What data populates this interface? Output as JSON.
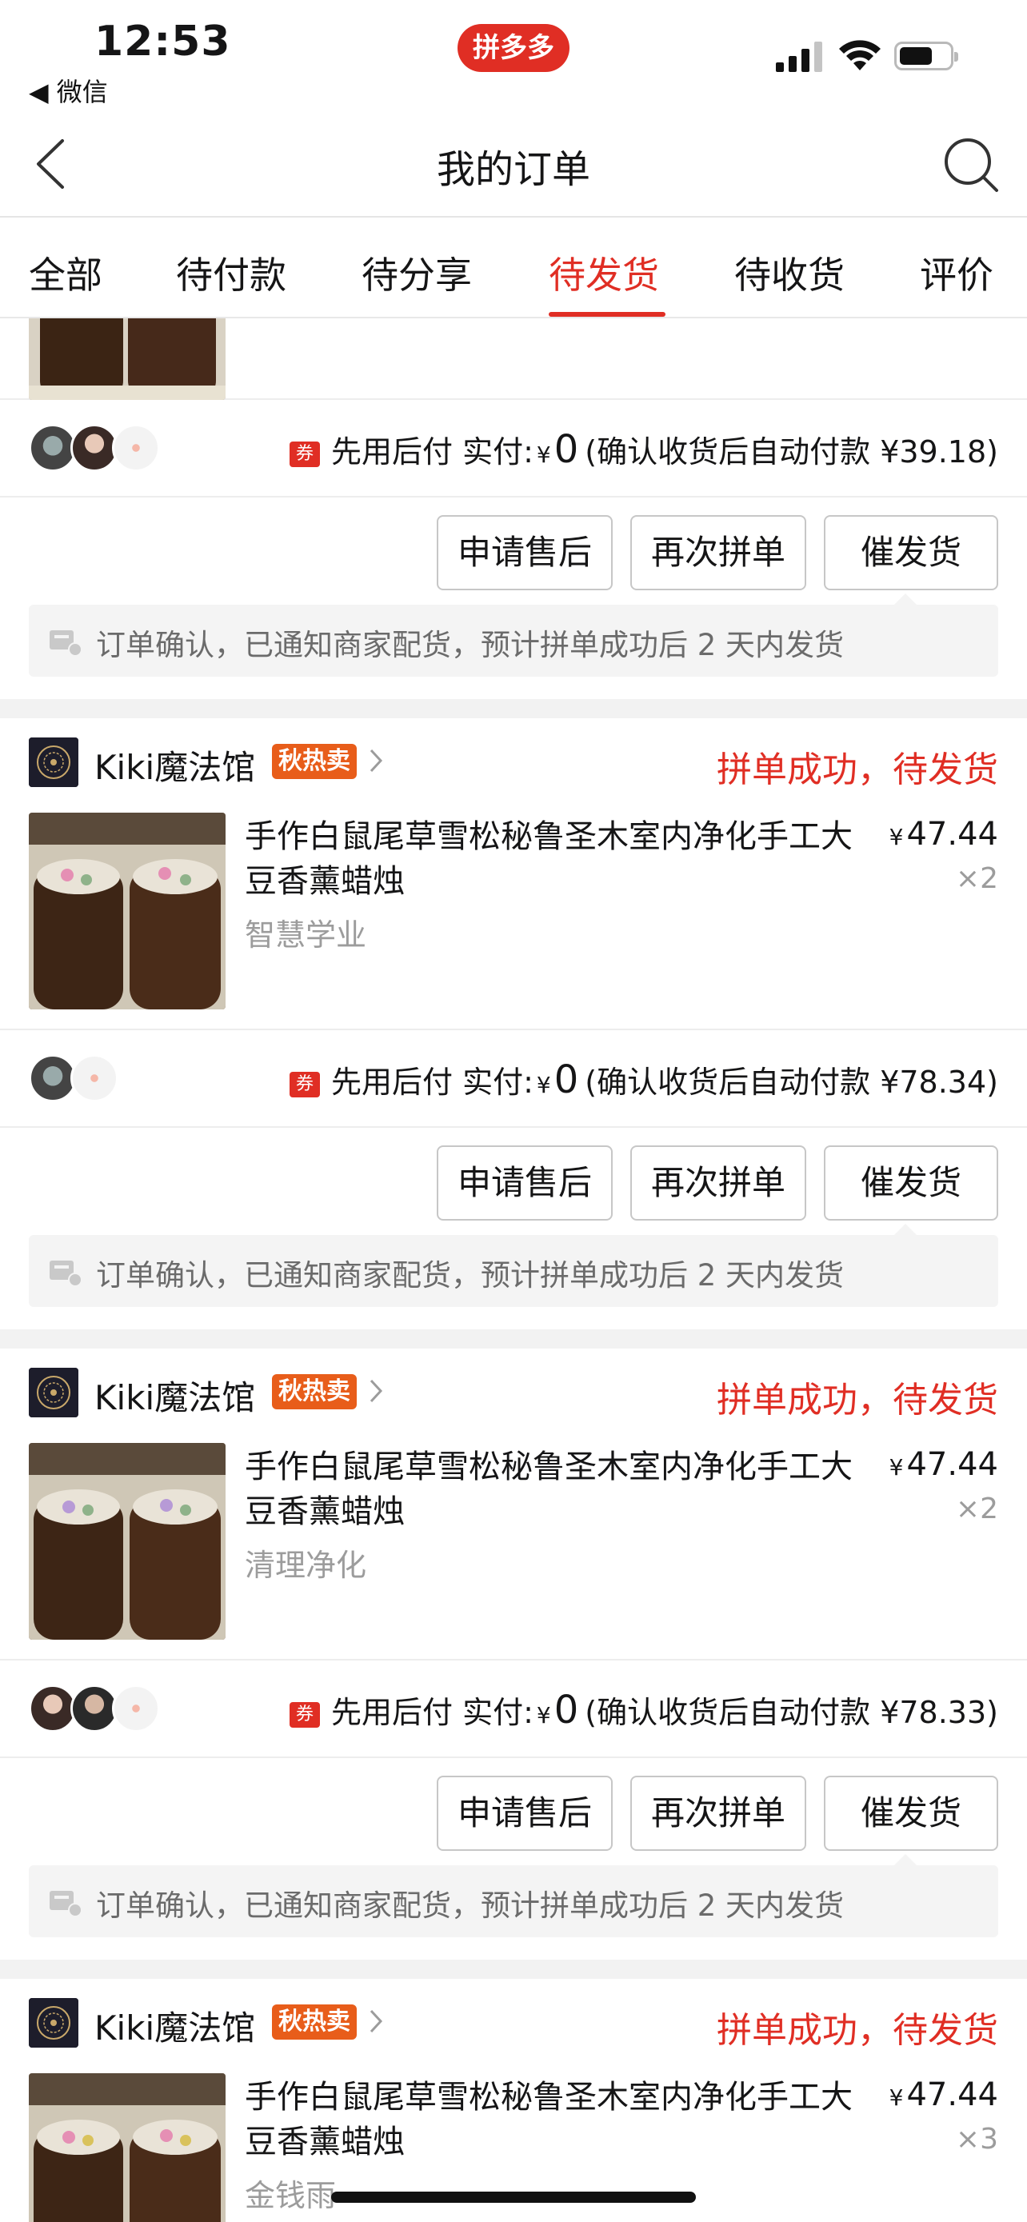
{
  "status_bar": {
    "time": "12:53",
    "back_app": "◀ 微信",
    "center_pill": "拼多多"
  },
  "nav": {
    "title": "我的订单"
  },
  "tabs": [
    {
      "label": "全部",
      "active": false
    },
    {
      "label": "待付款",
      "active": false
    },
    {
      "label": "待分享",
      "active": false
    },
    {
      "label": "待发货",
      "active": true
    },
    {
      "label": "待收货",
      "active": false
    },
    {
      "label": "评价",
      "active": false
    }
  ],
  "colors": {
    "accent": "#e02e24",
    "tag_orange": "#e85d1a",
    "muted_text": "#9c9c9c",
    "page_bg": "#f2f2f2"
  },
  "buttons": {
    "after_sales": "申请售后",
    "regroup": "再次拼单",
    "urge": "催发货"
  },
  "orders": [
    {
      "partial_top": true,
      "pay": {
        "coupon": "券",
        "prefix": "先用后付 实付:",
        "yen": "¥",
        "paid": "0",
        "note": "(确认收货后自动付款 ¥39.18)"
      },
      "notice": "订单确认，已通知商家配货，预计拼单成功后 2 天内发货"
    },
    {
      "shop": {
        "name": "Kiki魔法馆",
        "tag": "秋热卖"
      },
      "status": "拼单成功，待发货",
      "goods": {
        "title": "手作白鼠尾草雪松秘鲁圣木室内净化手工大豆香薰蜡烛",
        "spec": "智慧学业",
        "price_symbol": "¥",
        "price": "47.44",
        "qty": "×2"
      },
      "pay": {
        "coupon": "券",
        "prefix": "先用后付 实付:",
        "yen": "¥",
        "paid": "0",
        "note": "(确认收货后自动付款 ¥78.34)"
      },
      "notice": "订单确认，已通知商家配货，预计拼单成功后 2 天内发货"
    },
    {
      "shop": {
        "name": "Kiki魔法馆",
        "tag": "秋热卖"
      },
      "status": "拼单成功，待发货",
      "goods": {
        "title": "手作白鼠尾草雪松秘鲁圣木室内净化手工大豆香薰蜡烛",
        "spec": "清理净化",
        "price_symbol": "¥",
        "price": "47.44",
        "qty": "×2"
      },
      "pay": {
        "coupon": "券",
        "prefix": "先用后付 实付:",
        "yen": "¥",
        "paid": "0",
        "note": "(确认收货后自动付款 ¥78.33)"
      },
      "notice": "订单确认，已通知商家配货，预计拼单成功后 2 天内发货"
    },
    {
      "shop": {
        "name": "Kiki魔法馆",
        "tag": "秋热卖"
      },
      "status": "拼单成功，待发货",
      "goods": {
        "title": "手作白鼠尾草雪松秘鲁圣木室内净化手工大豆香薰蜡烛",
        "spec": "金钱雨",
        "price_symbol": "¥",
        "price": "47.44",
        "qty": "×3"
      }
    }
  ]
}
